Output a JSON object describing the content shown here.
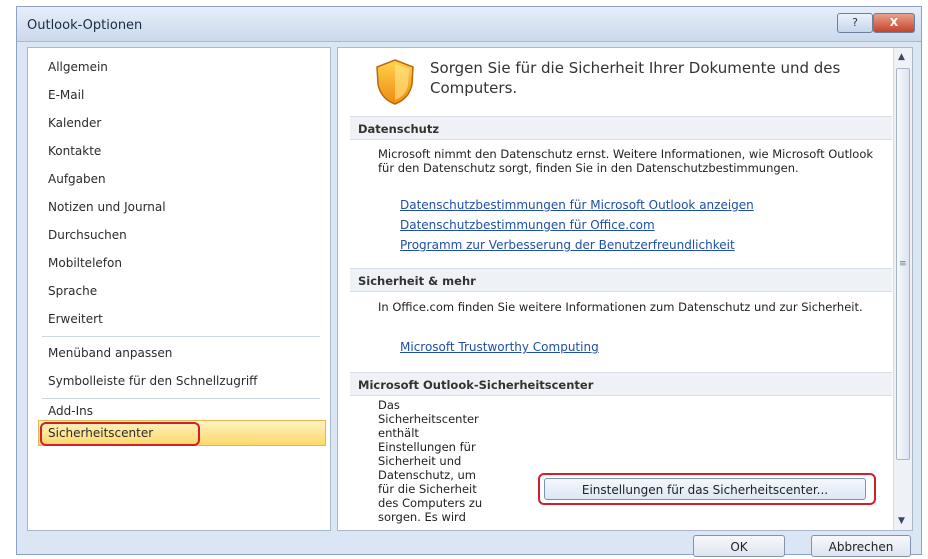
{
  "window": {
    "title": "Outlook-Optionen",
    "help_label": "?",
    "close_label": "X"
  },
  "nav": {
    "items": [
      {
        "label": "Allgemein"
      },
      {
        "label": "E-Mail"
      },
      {
        "label": "Kalender"
      },
      {
        "label": "Kontakte"
      },
      {
        "label": "Aufgaben"
      },
      {
        "label": "Notizen und Journal"
      },
      {
        "label": "Durchsuchen"
      },
      {
        "label": "Mobiltelefon"
      },
      {
        "label": "Sprache"
      },
      {
        "label": "Erweitert"
      },
      {
        "label": "Menüband anpassen"
      },
      {
        "label": "Symbolleiste für den Schnellzugriff"
      },
      {
        "label": "Add-Ins"
      },
      {
        "label": "Sicherheitscenter"
      }
    ],
    "selected": "Sicherheitscenter"
  },
  "content": {
    "headline": "Sorgen Sie für die Sicherheit Ihrer Dokumente und des Computers.",
    "sections": [
      {
        "header": "Datenschutz",
        "text": "Microsoft nimmt den Datenschutz ernst. Weitere Informationen, wie Microsoft Outlook für den Datenschutz sorgt, finden Sie in den Datenschutzbestimmungen.",
        "links": [
          "Datenschutzbestimmungen für Microsoft Outlook anzeigen",
          "Datenschutzbestimmungen für Office.com",
          "Programm zur Verbesserung der Benutzerfreundlichkeit"
        ]
      },
      {
        "header": "Sicherheit & mehr",
        "text": "In Office.com finden Sie weitere Informationen zum Datenschutz und zur Sicherheit.",
        "links": [
          "Microsoft Trustworthy Computing"
        ]
      },
      {
        "header": "Microsoft Outlook-Sicherheitscenter",
        "text": "Das\nSicherheitscenter\nenthält\nEinstellungen für\nSicherheit und\nDatenschutz, um\nfür die Sicherheit\ndes Computers zu\nsorgen. Es wird",
        "button": "Einstellungen für das Sicherheitscenter..."
      }
    ]
  },
  "footer": {
    "ok": "OK",
    "cancel": "Abbrechen"
  },
  "colors": {
    "highlight_red": "#d0202a",
    "link_blue": "#1f4fa8",
    "selected_bg": "#fdd86a"
  }
}
